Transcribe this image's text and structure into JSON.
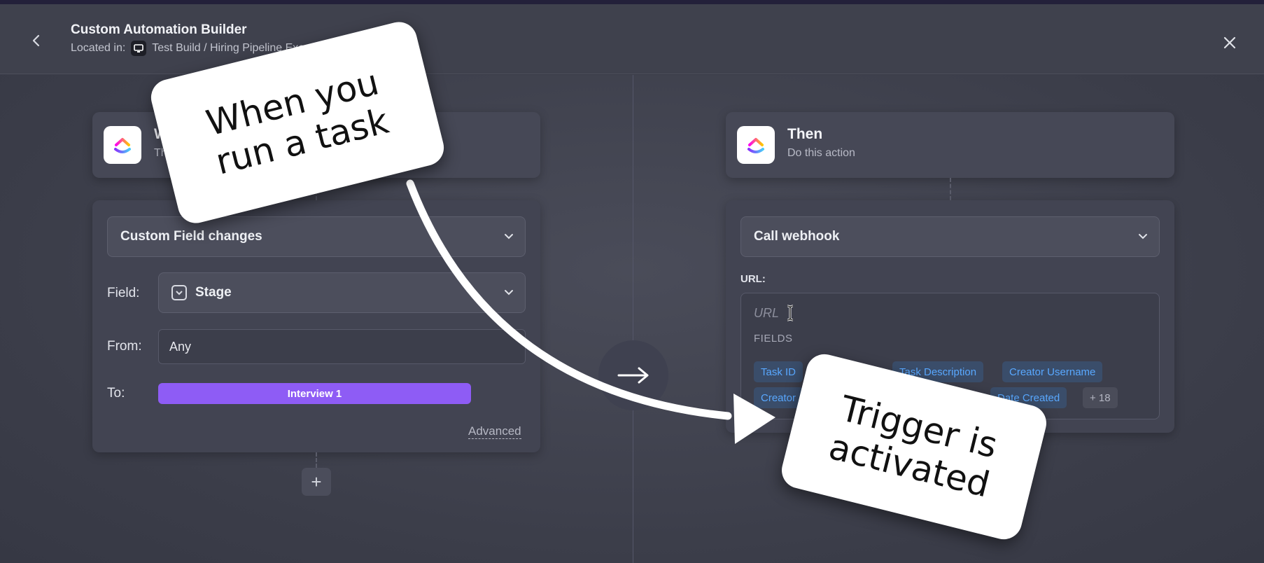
{
  "header": {
    "title": "Custom Automation Builder",
    "location_prefix": "Located in:",
    "location_path": "Test Build / Hiring Pipeline Exa"
  },
  "trigger": {
    "title": "W",
    "subtitle": "Th",
    "event_select": "Custom Field changes",
    "field_label": "Field:",
    "field_value": "Stage",
    "from_label": "From:",
    "from_value": "Any",
    "to_label": "To:",
    "to_value": "Interview 1",
    "advanced_link": "Advanced",
    "add_button": "+"
  },
  "action": {
    "title": "Then",
    "subtitle": "Do this action",
    "action_select": "Call webhook",
    "url_label": "URL:",
    "url_placeholder": "URL",
    "fields_label": "FIELDS",
    "chips_row1": [
      "Task ID",
      "Task Description",
      "Creator Username"
    ],
    "chips_row2": [
      "Creator",
      "Date Created",
      "+ 18"
    ]
  },
  "annotations": {
    "sticker_1_line1": "When you",
    "sticker_1_line2": "run a task",
    "sticker_2_line1": "Trigger is",
    "sticker_2_line2": "activated"
  },
  "colors": {
    "accent_purple": "#8e5cf5",
    "chip_text": "#59a8ff",
    "background": "#3a3c48"
  }
}
